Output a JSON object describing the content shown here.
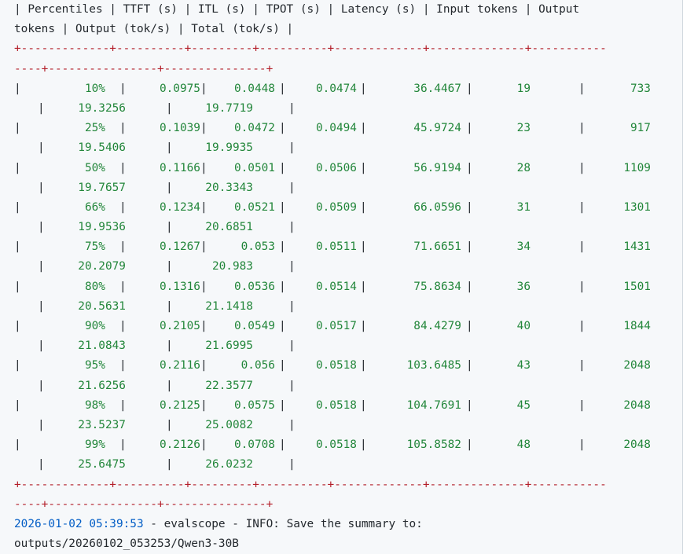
{
  "header_line1": "| Percentiles | TTFT (s) | ITL (s) | TPOT (s) | Latency (s) | Input tokens | Output",
  "header_line2": "tokens | Output (tok/s) | Total (tok/s) |",
  "separator_line1": "+-------------+----------+---------+----------+-------------+--------------+-----------",
  "separator_line2": "----+----------------+---------------+",
  "rows": [
    {
      "p": "10%",
      "ttft": "0.0975",
      "itl": "0.0448",
      "tpot": "0.0474",
      "latency": "36.4467",
      "input": "19",
      "output": "733",
      "out_tps": "19.3256",
      "total_tps": "19.7719"
    },
    {
      "p": "25%",
      "ttft": "0.1039",
      "itl": "0.0472",
      "tpot": "0.0494",
      "latency": "45.9724",
      "input": "23",
      "output": "917",
      "out_tps": "19.5406",
      "total_tps": "19.9935"
    },
    {
      "p": "50%",
      "ttft": "0.1166",
      "itl": "0.0501",
      "tpot": "0.0506",
      "latency": "56.9194",
      "input": "28",
      "output": "1109",
      "out_tps": "19.7657",
      "total_tps": "20.3343"
    },
    {
      "p": "66%",
      "ttft": "0.1234",
      "itl": "0.0521",
      "tpot": "0.0509",
      "latency": "66.0596",
      "input": "31",
      "output": "1301",
      "out_tps": "19.9536",
      "total_tps": "20.6851"
    },
    {
      "p": "75%",
      "ttft": "0.1267",
      "itl": "0.053",
      "tpot": "0.0511",
      "latency": "71.6651",
      "input": "34",
      "output": "1431",
      "out_tps": "20.2079",
      "total_tps": "20.983"
    },
    {
      "p": "80%",
      "ttft": "0.1316",
      "itl": "0.0536",
      "tpot": "0.0514",
      "latency": "75.8634",
      "input": "36",
      "output": "1501",
      "out_tps": "20.5631",
      "total_tps": "21.1418"
    },
    {
      "p": "90%",
      "ttft": "0.2105",
      "itl": "0.0549",
      "tpot": "0.0517",
      "latency": "84.4279",
      "input": "40",
      "output": "1844",
      "out_tps": "21.0843",
      "total_tps": "21.6995"
    },
    {
      "p": "95%",
      "ttft": "0.2116",
      "itl": "0.056",
      "tpot": "0.0518",
      "latency": "103.6485",
      "input": "43",
      "output": "2048",
      "out_tps": "21.6256",
      "total_tps": "22.3577"
    },
    {
      "p": "98%",
      "ttft": "0.2125",
      "itl": "0.0575",
      "tpot": "0.0518",
      "latency": "104.7691",
      "input": "45",
      "output": "2048",
      "out_tps": "23.5237",
      "total_tps": "25.0082"
    },
    {
      "p": "99%",
      "ttft": "0.2126",
      "itl": "0.0708",
      "tpot": "0.0518",
      "latency": "105.8582",
      "input": "48",
      "output": "2048",
      "out_tps": "25.6475",
      "total_tps": "26.0232"
    }
  ],
  "log_line": {
    "date": "2026-01-02",
    "time": "05:39:53",
    "rest": " - evalscope - INFO: Save the summary to:"
  },
  "path_line": "outputs/20260102_053253/Qwen3-30B",
  "colors": {
    "background": "#f6f8fa",
    "text": "#24292e",
    "separator": "#b31d28",
    "number": "#22863a",
    "date": "#005cc5"
  }
}
